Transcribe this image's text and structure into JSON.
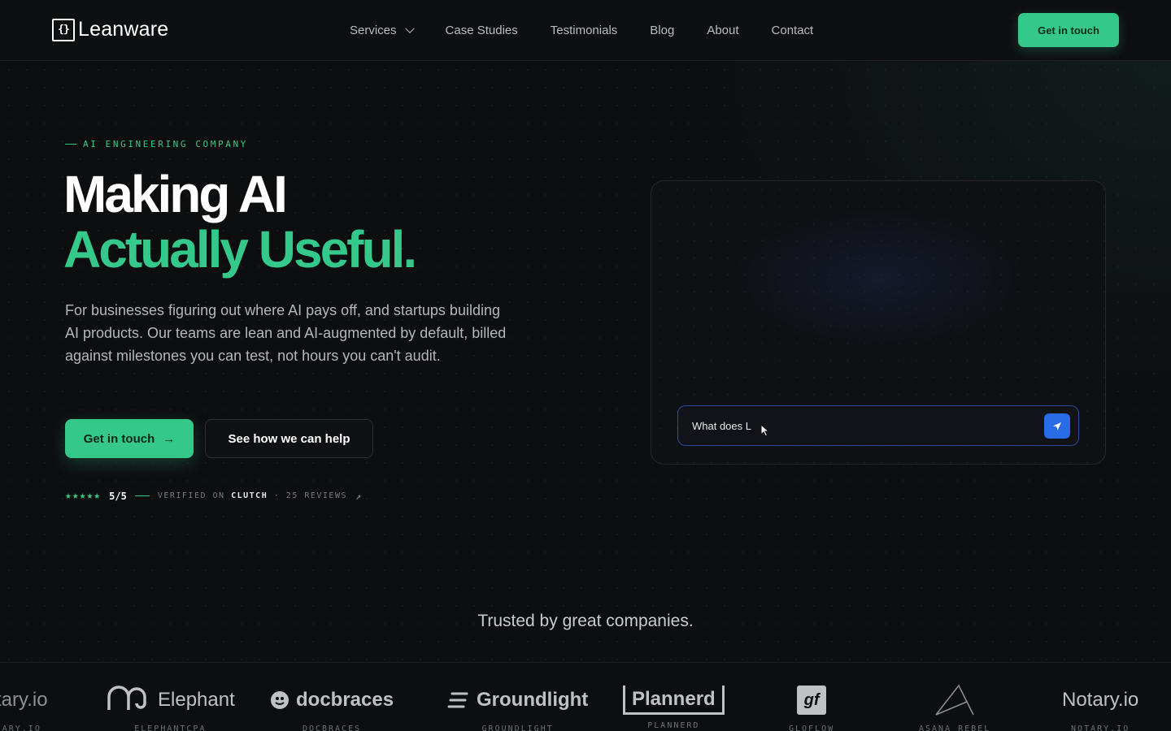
{
  "nav": {
    "brand": "Leanware",
    "brand_mark": "{}",
    "links": [
      "Services",
      "Case Studies",
      "Testimonials",
      "Blog",
      "About",
      "Contact"
    ],
    "cta": "Get in touch"
  },
  "hero": {
    "eyebrow": "AI ENGINEERING COMPANY",
    "title_line1": "Making AI",
    "title_line2": "Actually Useful.",
    "lead": "For businesses figuring out where AI pays off, and startups building AI products. Our teams are lean and AI-augmented by default, billed against milestones you can test, not hours you can't audit.",
    "primary_cta": "Get in touch",
    "primary_cta_icon": "→",
    "secondary_cta": "See how we can help",
    "rating": {
      "stars": "★★★★★",
      "score": "5/5",
      "verified_prefix": "VERIFIED ON",
      "platform": "CLUTCH",
      "reviews": "· 25 REVIEWS",
      "external_icon": "↗"
    }
  },
  "chat": {
    "input_value": "What does L"
  },
  "trusted": {
    "heading": "Trusted by great companies.",
    "logos": [
      {
        "name": "tary.io",
        "caption": "ARY.IO"
      },
      {
        "name": "Elephant",
        "caption": "ELEPHANTCPA"
      },
      {
        "name": "docbraces",
        "caption": "DOCBRACES"
      },
      {
        "name": "Groundlight",
        "caption": "GROUNDLIGHT"
      },
      {
        "name": "Plannerd",
        "caption": "PLANNERD"
      },
      {
        "name": "gf",
        "caption": "GLOFLOW"
      },
      {
        "name": "",
        "caption": "ASANA REBEL"
      },
      {
        "name": "Notary.io",
        "caption": "NOTARY.IO"
      }
    ]
  },
  "colors": {
    "accent": "#34c98a",
    "background": "#0d0e10",
    "send_button": "#2a6be8"
  }
}
